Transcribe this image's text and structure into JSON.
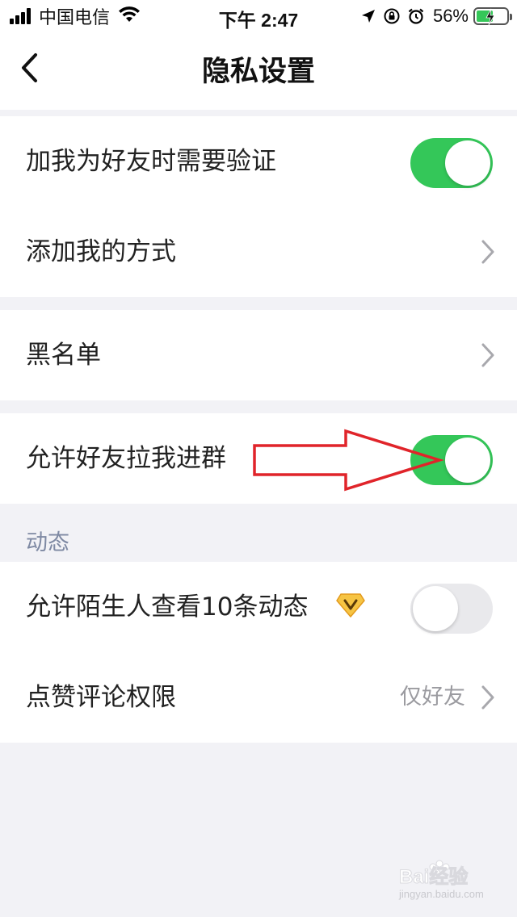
{
  "status_bar": {
    "carrier": "中国电信",
    "time": "下午 2:47",
    "battery_percent": "56%",
    "battery_level": 0.56
  },
  "nav": {
    "title": "隐私设置",
    "back_icon": "chevron-left-icon"
  },
  "rows": {
    "verify_friend": {
      "label": "加我为好友时需要验证",
      "enabled": true
    },
    "add_methods": {
      "label": "添加我的方式"
    },
    "blacklist": {
      "label": "黑名单"
    },
    "allow_group_invite": {
      "label": "允许好友拉我进群",
      "enabled": true
    },
    "stranger_view": {
      "label": "允许陌生人查看10条动态",
      "enabled": false,
      "badge_icon": "vip-badge-icon"
    },
    "like_comment": {
      "label": "点赞评论权限",
      "value": "仅好友"
    }
  },
  "sections": {
    "dynamics_header": "动态"
  },
  "watermark": {
    "line1": "Bai经验",
    "line2": "jingyan.baidu.com"
  },
  "colors": {
    "toggle_on": "#34c759",
    "toggle_off": "#e9e9ec",
    "background": "#f2f2f6",
    "section_header": "#7e89a3",
    "annotation_arrow": "#e0242a"
  }
}
